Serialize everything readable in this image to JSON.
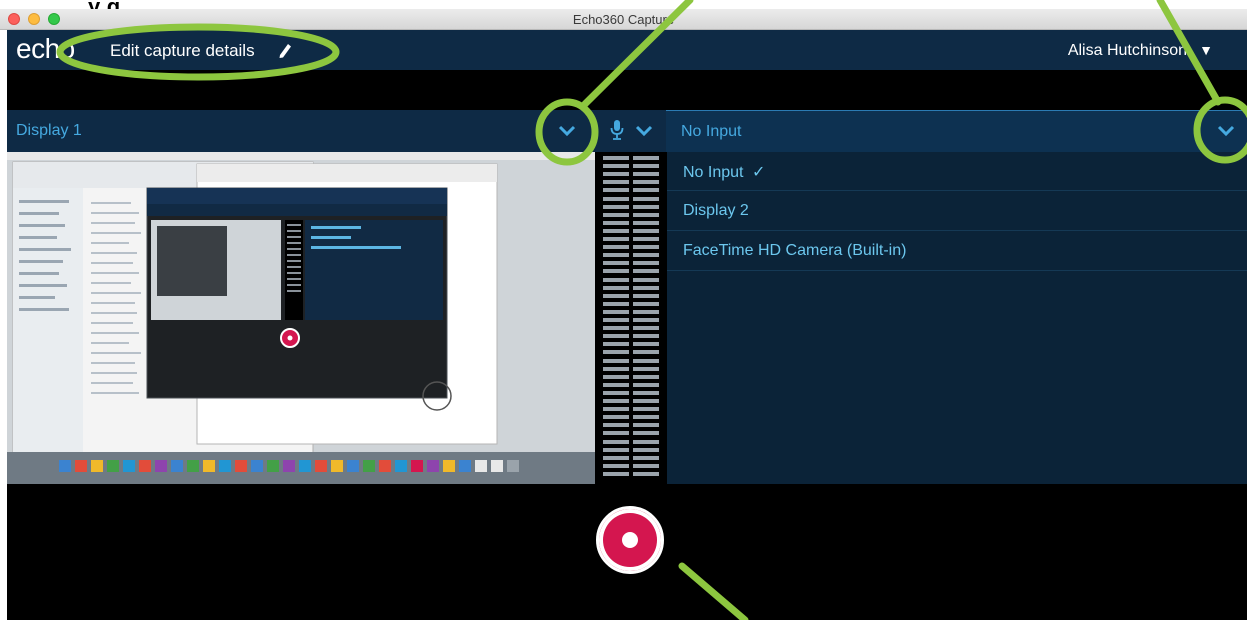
{
  "doc_caption_fragment": "y           g",
  "window": {
    "title": "Echo360 Capture"
  },
  "app": {
    "logo": "echo",
    "edit_details_label": "Edit capture details",
    "edit_icon": "pencil-icon",
    "user_name": "Alisa Hutchinson",
    "user_menu_caret": "▼"
  },
  "sources": {
    "left": {
      "label": "Display 1",
      "dropdown_icon": "chevron-down-icon"
    },
    "audio": {
      "icon": "microphone-icon",
      "dropdown_icon": "chevron-down-icon"
    },
    "right": {
      "label": "No Input",
      "dropdown_icon": "chevron-down-icon",
      "menu": [
        {
          "label": "No Input",
          "selected": true,
          "check": "✓"
        },
        {
          "label": "Display 2",
          "selected": false
        },
        {
          "label": "FaceTime HD Camera (Built-in)",
          "selected": false
        }
      ]
    }
  },
  "record_button": {
    "icon": "record-icon"
  },
  "colors": {
    "app_header": "#0e2a45",
    "accent_text": "#45a9e0",
    "menu_text": "#6cc7ee",
    "record_red": "#d4164f",
    "annotation_green": "#8dc63f"
  }
}
